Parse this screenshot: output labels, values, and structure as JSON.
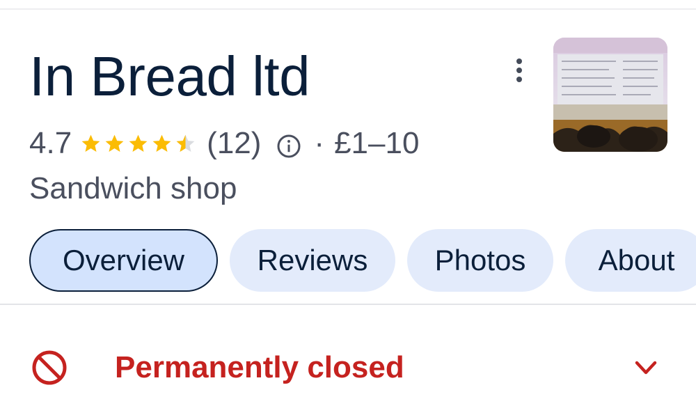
{
  "place": {
    "name": "In Bread ltd",
    "rating": "4.7",
    "stars_filled": 4.5,
    "stars_total": 5,
    "review_count": "(12)",
    "separator": "·",
    "price_range": "£1–10",
    "category": "Sandwich shop"
  },
  "tabs": [
    {
      "label": "Overview",
      "active": true
    },
    {
      "label": "Reviews",
      "active": false
    },
    {
      "label": "Photos",
      "active": false
    },
    {
      "label": "About",
      "active": false
    }
  ],
  "status": {
    "label": "Permanently closed"
  },
  "colors": {
    "title": "#0b1f3a",
    "star": "#fbbc04",
    "star_empty": "#dadce0",
    "closed": "#c5221f",
    "tab_bg": "#e3ebfb",
    "tab_active_bg": "#d3e3fd"
  },
  "icons": {
    "more": "more-vert-icon",
    "info": "info-icon",
    "closed": "block-icon",
    "expand": "chevron-down-icon"
  }
}
